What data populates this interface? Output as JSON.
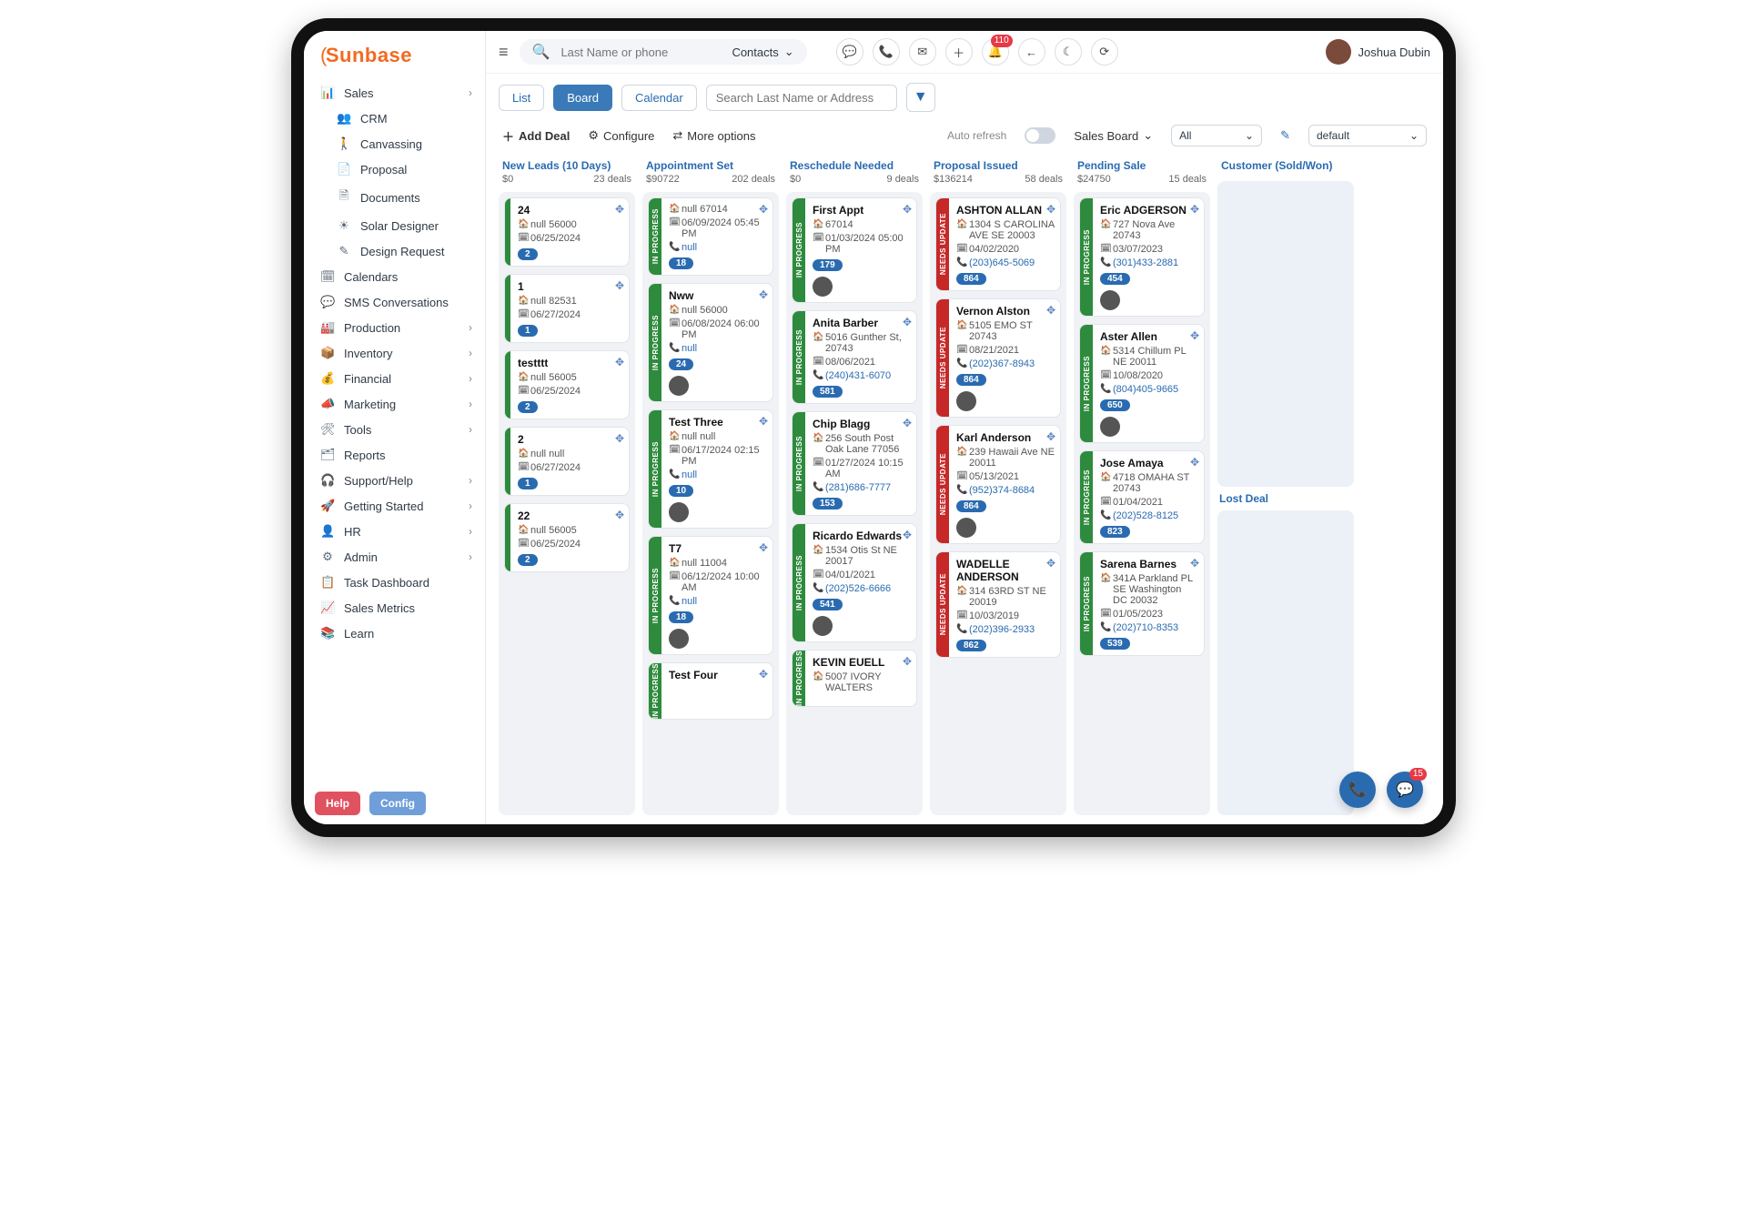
{
  "brand": "Sunbase",
  "user": {
    "name": "Joshua Dubin"
  },
  "search": {
    "placeholder": "Last Name or phone",
    "category": "Contacts"
  },
  "notifications": "110",
  "sidebar": [
    {
      "label": "Sales",
      "icon": "📊",
      "expandable": true
    },
    {
      "label": "CRM",
      "icon": "👥",
      "sub": true
    },
    {
      "label": "Canvassing",
      "icon": "🚶",
      "sub": true
    },
    {
      "label": "Proposal",
      "icon": "📄",
      "sub": true
    },
    {
      "label": "Documents",
      "icon": "🗎",
      "sub": true
    },
    {
      "label": "Solar Designer",
      "icon": "☀",
      "sub": true
    },
    {
      "label": "Design Request",
      "icon": "✎",
      "sub": true
    },
    {
      "label": "Calendars",
      "icon": "🗓"
    },
    {
      "label": "SMS Conversations",
      "icon": "💬"
    },
    {
      "label": "Production",
      "icon": "🏭",
      "expandable": true
    },
    {
      "label": "Inventory",
      "icon": "📦",
      "expandable": true
    },
    {
      "label": "Financial",
      "icon": "💰",
      "expandable": true
    },
    {
      "label": "Marketing",
      "icon": "📣",
      "expandable": true
    },
    {
      "label": "Tools",
      "icon": "🛠",
      "expandable": true
    },
    {
      "label": "Reports",
      "icon": "🗂"
    },
    {
      "label": "Support/Help",
      "icon": "🎧",
      "expandable": true
    },
    {
      "label": "Getting Started",
      "icon": "🚀",
      "expandable": true
    },
    {
      "label": "HR",
      "icon": "👤",
      "expandable": true
    },
    {
      "label": "Admin",
      "icon": "⚙",
      "expandable": true
    },
    {
      "label": "Task Dashboard",
      "icon": "📋"
    },
    {
      "label": "Sales Metrics",
      "icon": "📈"
    },
    {
      "label": "Learn",
      "icon": "📚"
    }
  ],
  "bottom": {
    "help": "Help",
    "config": "Config"
  },
  "views": {
    "list": "List",
    "board": "Board",
    "calendar": "Calendar"
  },
  "addr_placeholder": "Search Last Name or Address",
  "options": {
    "add": "Add Deal",
    "configure": "Configure",
    "more": "More options",
    "auto": "Auto refresh",
    "board": "Sales Board",
    "filter_all": "All",
    "preset": "default"
  },
  "columns": [
    {
      "title": "New Leads (10 Days)",
      "amount": "$0",
      "deals": "23 deals",
      "cards": [
        {
          "name": "24",
          "addr": "null 56000",
          "date": "06/25/2024",
          "badge": "2"
        },
        {
          "name": "1",
          "addr": "null 82531",
          "date": "06/27/2024",
          "badge": "1"
        },
        {
          "name": "testttt",
          "addr": "null 56005",
          "date": "06/25/2024",
          "badge": "2"
        },
        {
          "name": "2",
          "addr": "null null",
          "date": "06/27/2024",
          "badge": "1"
        },
        {
          "name": "22",
          "addr": "null 56005",
          "date": "06/25/2024",
          "badge": "2"
        }
      ]
    },
    {
      "title": "Appointment Set",
      "amount": "$90722",
      "deals": "202 deals",
      "cards": [
        {
          "stripe": "green",
          "strip_txt": "IN PROGRESS",
          "name": "",
          "addr": "null 67014",
          "date": "06/09/2024 05:45 PM",
          "phone": "null",
          "badge": "18"
        },
        {
          "stripe": "green",
          "strip_txt": "IN PROGRESS",
          "name": "Nww",
          "addr": "null 56000",
          "date": "06/08/2024 06:00 PM",
          "phone": "null",
          "badge": "24",
          "avatar": true
        },
        {
          "stripe": "green",
          "strip_txt": "IN PROGRESS",
          "name": "Test Three",
          "addr": "null null",
          "date": "06/17/2024 02:15 PM",
          "phone": "null",
          "badge": "10",
          "avatar": true
        },
        {
          "stripe": "green",
          "strip_txt": "IN PROGRESS",
          "name": "T7",
          "addr": "null 11004",
          "date": "06/12/2024 10:00 AM",
          "phone": "null",
          "badge": "18",
          "avatar": true
        },
        {
          "stripe": "green",
          "strip_txt": "IN PROGRESS",
          "name": "Test Four"
        }
      ]
    },
    {
      "title": "Reschedule Needed",
      "amount": "$0",
      "deals": "9 deals",
      "cards": [
        {
          "stripe": "green",
          "strip_txt": "IN PROGRESS",
          "name": "First Appt",
          "addr": "67014",
          "date": "01/03/2024 05:00 PM",
          "badge": "179",
          "avatar": true
        },
        {
          "stripe": "green",
          "strip_txt": "IN PROGRESS",
          "name": "Anita Barber",
          "addr": "5016 Gunther St, 20743",
          "date": "08/06/2021",
          "phone": "(240)431-6070",
          "badge": "581"
        },
        {
          "stripe": "green",
          "strip_txt": "IN PROGRESS",
          "name": "Chip Blagg",
          "addr": "256 South Post Oak Lane 77056",
          "date": "01/27/2024 10:15 AM",
          "phone": "(281)686-7777",
          "badge": "153"
        },
        {
          "stripe": "green",
          "strip_txt": "IN PROGRESS",
          "name": "Ricardo Edwards",
          "addr": "1534 Otis St NE 20017",
          "date": "04/01/2021",
          "phone": "(202)526-6666",
          "badge": "541",
          "avatar": true
        },
        {
          "stripe": "green",
          "strip_txt": "IN PROGRESS",
          "name": "KEVIN EUELL",
          "addr": "5007 IVORY WALTERS"
        }
      ]
    },
    {
      "title": "Proposal Issued",
      "amount": "$136214",
      "deals": "58 deals",
      "cards": [
        {
          "stripe": "red",
          "strip_txt": "NEEDS UPDATE",
          "name": "ASHTON ALLAN",
          "addr": "1304 S CAROLINA AVE SE 20003",
          "date": "04/02/2020",
          "phone": "(203)645-5069",
          "badge": "864"
        },
        {
          "stripe": "red",
          "strip_txt": "NEEDS UPDATE",
          "name": "Vernon Alston",
          "addr": "5105 EMO ST 20743",
          "date": "08/21/2021",
          "phone": "(202)367-8943",
          "badge": "864",
          "avatar": true
        },
        {
          "stripe": "red",
          "strip_txt": "NEEDS UPDATE",
          "name": "Karl Anderson",
          "addr": "239 Hawaii Ave NE 20011",
          "date": "05/13/2021",
          "phone": "(952)374-8684",
          "badge": "864",
          "avatar": true
        },
        {
          "stripe": "red",
          "strip_txt": "NEEDS UPDATE",
          "name": "WADELLE ANDERSON",
          "addr": "314 63RD ST NE 20019",
          "date": "10/03/2019",
          "phone": "(202)396-2933",
          "badge": "862"
        }
      ]
    },
    {
      "title": "Pending Sale",
      "amount": "$24750",
      "deals": "15 deals",
      "cards": [
        {
          "stripe": "green",
          "strip_txt": "IN PROGRESS",
          "name": "Eric ADGERSON",
          "addr": "727 Nova Ave 20743",
          "date": "03/07/2023",
          "phone": "(301)433-2881",
          "badge": "454",
          "avatar": true
        },
        {
          "stripe": "green",
          "strip_txt": "IN PROGRESS",
          "name": "Aster Allen",
          "addr": "5314 Chillum PL NE 20011",
          "date": "10/08/2020",
          "phone": "(804)405-9665",
          "badge": "650",
          "avatar": true
        },
        {
          "stripe": "green",
          "strip_txt": "IN PROGRESS",
          "name": "Jose Amaya",
          "addr": "4718 OMAHA ST 20743",
          "date": "01/04/2021",
          "phone": "(202)528-8125",
          "badge": "823"
        },
        {
          "stripe": "green",
          "strip_txt": "IN PROGRESS",
          "name": "Sarena Barnes",
          "addr": "341A Parkland PL SE Washington DC 20032",
          "date": "01/05/2023",
          "phone": "(202)710-8353",
          "badge": "539"
        }
      ]
    },
    {
      "title": "Customer (Sold/Won)",
      "amount": "",
      "deals": "",
      "cards": [],
      "lost_label": "Lost Deal"
    }
  ],
  "fab_badge": "15"
}
